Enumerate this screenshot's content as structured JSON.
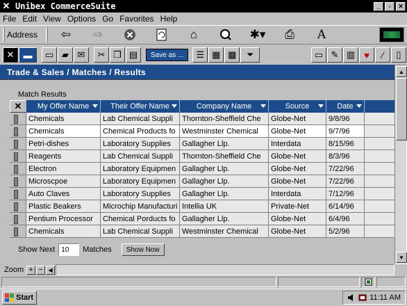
{
  "window": {
    "title": "Unibex CommerceSuite",
    "min": "_",
    "max": "▫",
    "close": "✕"
  },
  "menu": [
    "File",
    "Edit",
    "View",
    "Options",
    "Go",
    "Favorites",
    "Help"
  ],
  "address_bar": {
    "label": "Address"
  },
  "toolbar": {
    "save_as_label": "Save as ..."
  },
  "breadcrumb": "Trade & Sales / Matches / Results",
  "results": {
    "caption": "Match Results",
    "columns": [
      "My Offer Name",
      "Their Offer Name",
      "Company Name",
      "Source",
      "Date"
    ],
    "rows": [
      [
        "Chemicals",
        "Lab Chemical Suppli",
        "Thornton-Sheffield Che",
        "Globe-Net",
        "9/8/96"
      ],
      [
        "Chemicals",
        "Chemical Products fo",
        "Westminster Chemical",
        "Globe-Net",
        "9/7/96"
      ],
      [
        "Petri-dishes",
        "Laboratory Supplies",
        "Gallagher Llp.",
        "Interdata",
        "8/15/96"
      ],
      [
        "Reagents",
        "Lab Chemical Suppli",
        "Thornton-Sheffield Che",
        "Globe-Net",
        "8/3/96"
      ],
      [
        "Electron",
        "Laboratory Equipmen",
        "Gallagher Llp.",
        "Globe-Net",
        "7/22/96"
      ],
      [
        "Microscpoe",
        "Laboratory Equipmen",
        "Gallagher Llp.",
        "Globe-Net",
        "7/22/96"
      ],
      [
        "Auto Claves",
        "Laboratory Supplies",
        "Gallagher Llp.",
        "Interdata",
        "7/12/96"
      ],
      [
        "Plastic Beakers",
        "Microchip Manufacturi",
        "Intellia UK",
        "Private-Net",
        "6/14/96"
      ],
      [
        "Pentium Processor",
        "Chemical Porducts fo",
        "Gallagher Llp.",
        "Globe-Net",
        "6/4/96"
      ],
      [
        "Chemicals",
        "Lab Chemical Suppli",
        "Westminster Chemical",
        "Globe-Net",
        "5/2/96"
      ]
    ],
    "selected_row": 1
  },
  "paging": {
    "show_next_label": "Show Next",
    "count": "10",
    "matches_label": "Matches",
    "show_now_label": "Show Now"
  },
  "zoom": {
    "label": "Zoom",
    "plus": "+",
    "minus": "−"
  },
  "taskbar": {
    "start_label": "Start",
    "clock": "11:11 AM"
  },
  "colors": {
    "header_blue": "#1c4c8c",
    "chrome_gray": "#c0c0c0",
    "title_black": "#000000"
  }
}
